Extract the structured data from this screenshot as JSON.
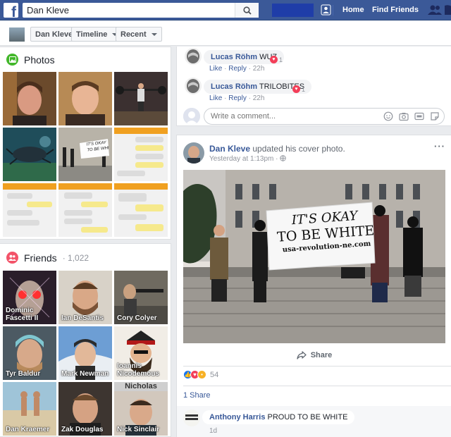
{
  "topbar": {
    "logo": "f",
    "search_value": "Dan Kleve",
    "nav_home": "Home",
    "nav_find_friends": "Find Friends"
  },
  "timeline_bar": {
    "name_button": "Dan Kleve",
    "timeline_dropdown": "Timeline",
    "recent_dropdown": "Recent"
  },
  "photos": {
    "title": "Photos",
    "sign_text_line1": "IT'S OKAY",
    "sign_text_line2": "TO BE WHI"
  },
  "friends": {
    "title": "Friends",
    "count": "1,022",
    "header_label": "Nicholas",
    "items": [
      {
        "name": "Dominic Fascetti II"
      },
      {
        "name": "Ian DeSantis"
      },
      {
        "name": "Cory Colyer"
      },
      {
        "name": "Tyr Baldur"
      },
      {
        "name": "Mark Newman"
      },
      {
        "name": "Ioannis Nicodemous"
      },
      {
        "name": "Dan Kraemer"
      },
      {
        "name": "Zak Douglas"
      },
      {
        "name": "Nick Sinclair"
      }
    ]
  },
  "comments": [
    {
      "author": "Lucas Röhm",
      "text": "WUZ",
      "reactions": "1",
      "like": "Like",
      "reply": "Reply",
      "time": "22h"
    },
    {
      "author": "Lucas Röhm",
      "text": "TRILOBITES",
      "reactions": "1",
      "like": "Like",
      "reply": "Reply",
      "time": "22h"
    }
  ],
  "write_comment": {
    "placeholder": "Write a comment..."
  },
  "post": {
    "author": "Dan Kleve",
    "action": "updated his cover photo.",
    "time": "Yesterday at 1:13pm",
    "sign_line1": "IT'S OKAY",
    "sign_line2": "TO BE WHITE",
    "sign_url": "usa-revolution-ne.com",
    "share_label": "Share",
    "reaction_count": "54",
    "shares_text": "1 Share"
  },
  "bottom_comment": {
    "author": "Anthony Harris",
    "text": "PROUD TO BE WHITE",
    "time": "1d"
  },
  "colors": {
    "brand": "#3b5998",
    "link": "#385898",
    "background": "#e9ebee",
    "love": "#f33e58",
    "like": "#1877f2",
    "wow": "#f7b125"
  }
}
